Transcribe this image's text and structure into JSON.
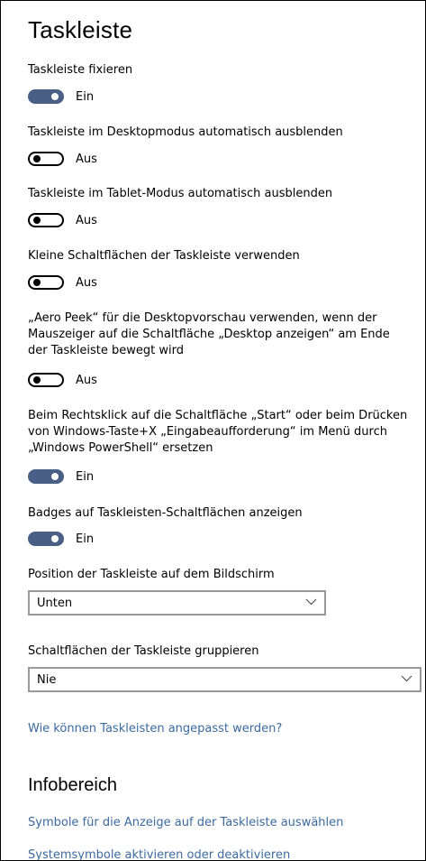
{
  "page": {
    "title": "Taskleiste"
  },
  "settings": [
    {
      "label": "Taskleiste fixieren",
      "state": "Ein"
    },
    {
      "label": "Taskleiste im Desktopmodus automatisch ausblenden",
      "state": "Aus"
    },
    {
      "label": "Taskleiste im Tablet-Modus automatisch ausblenden",
      "state": "Aus"
    },
    {
      "label": "Kleine Schaltflächen der Taskleiste verwenden",
      "state": "Aus"
    },
    {
      "label": "„Aero Peek“ für die Desktopvorschau verwenden, wenn der Mauszeiger auf die Schaltfläche „Desktop anzeigen“ am Ende der Taskleiste bewegt wird",
      "state": "Aus"
    },
    {
      "label": "Beim Rechtsklick auf die Schaltfläche „Start“ oder beim Drücken von Windows-Taste+X „Eingabeaufforderung“ im Menü durch „Windows PowerShell“ ersetzen",
      "state": "Ein"
    },
    {
      "label": "Badges auf Taskleisten-Schaltflächen anzeigen",
      "state": "Ein"
    }
  ],
  "position": {
    "label": "Position der Taskleiste auf dem Bildschirm",
    "value": "Unten"
  },
  "grouping": {
    "label": "Schaltflächen der Taskleiste gruppieren",
    "value": "Nie"
  },
  "help_link": "Wie können Taskleisten angepasst werden?",
  "notification_area": {
    "title": "Infobereich",
    "links": [
      "Symbole für die Anzeige auf der Taskleiste auswählen",
      "Systemsymbole aktivieren oder deaktivieren"
    ]
  },
  "colors": {
    "toggle_on": "#4a5f86",
    "link": "#3c6aa0",
    "dropdown_border": "#999999"
  },
  "icons": {
    "dropdown": "chevron-down-icon"
  }
}
